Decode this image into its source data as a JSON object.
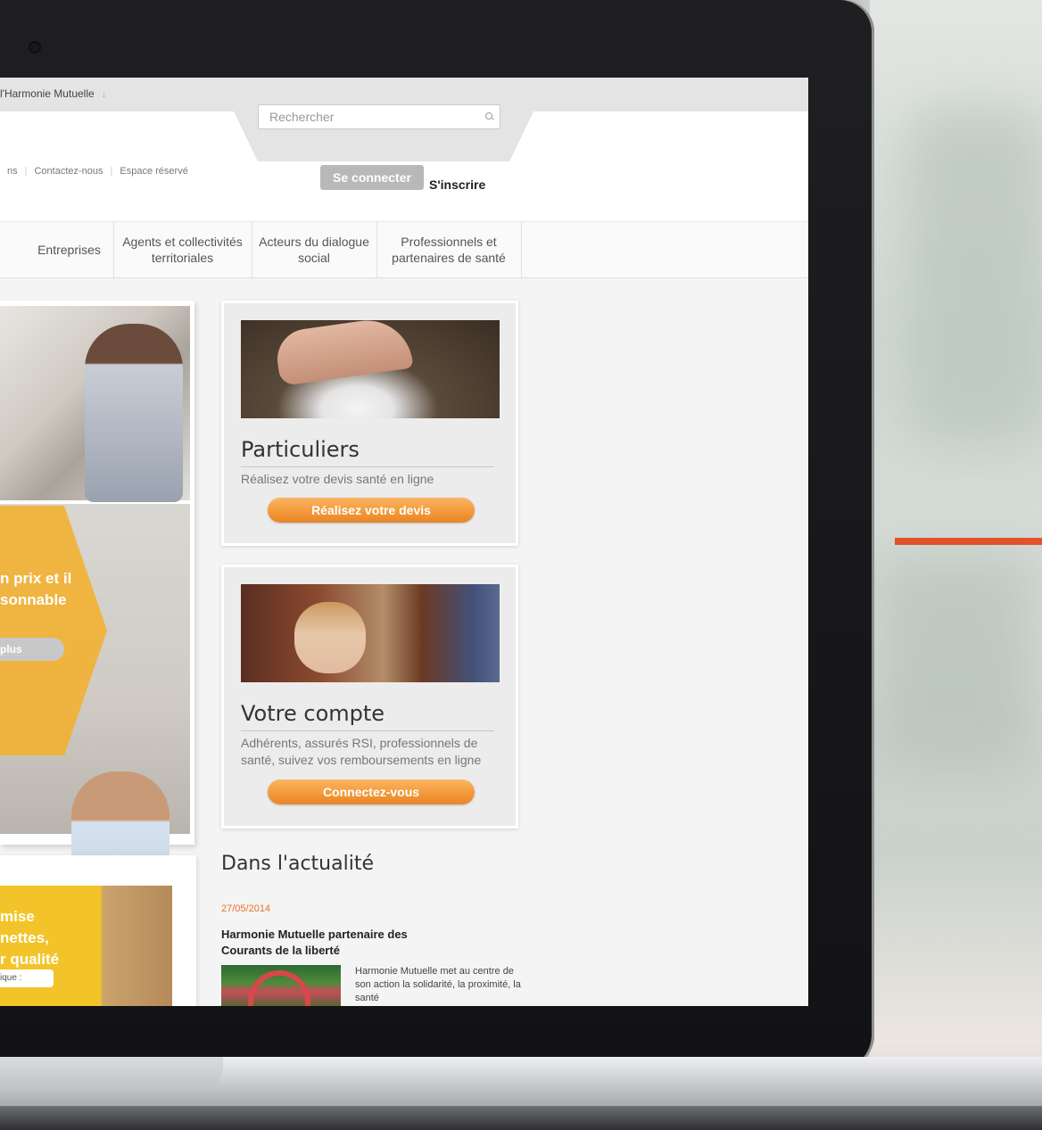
{
  "site": {
    "brand": "l'Harmonie Mutuelle",
    "brand_arrow": "↓",
    "search_placeholder": "Rechercher",
    "header_links": [
      "ns",
      "Contactez-nous",
      "Espace réservé"
    ],
    "login_label": "Se connecter",
    "signup_label": "S'inscrire"
  },
  "nav": {
    "items": [
      "Entreprises",
      "Agents et collectivités territoriales",
      "Acteurs du dialogue social",
      "Professionnels et partenaires de santé"
    ]
  },
  "hero": {
    "promo_line1": "n prix et il",
    "promo_line2": "sonnable",
    "more_label": "plus"
  },
  "promo2": {
    "line1": "mise",
    "line2": "nettes,",
    "line3": "r qualité",
    "small": "ique :"
  },
  "cards": [
    {
      "title": "Particuliers",
      "description": "Réalisez votre devis santé en ligne",
      "cta": "Réalisez votre devis"
    },
    {
      "title": "Votre compte",
      "description": "Adhérents, assurés RSI, professionnels de santé, suivez vos remboursements en ligne",
      "cta": "Connectez-vous"
    }
  ],
  "news": {
    "section_title": "Dans l'actualité",
    "date": "27/05/2014",
    "headline": "Harmonie Mutuelle partenaire des Courants de la liberté",
    "body": "Harmonie Mutuelle met au centre de son action la solidarité, la proximité, la santé"
  },
  "colors": {
    "accent": "#e2532b",
    "cta_orange": "#f39a3a",
    "news_date": "#e8732a"
  }
}
